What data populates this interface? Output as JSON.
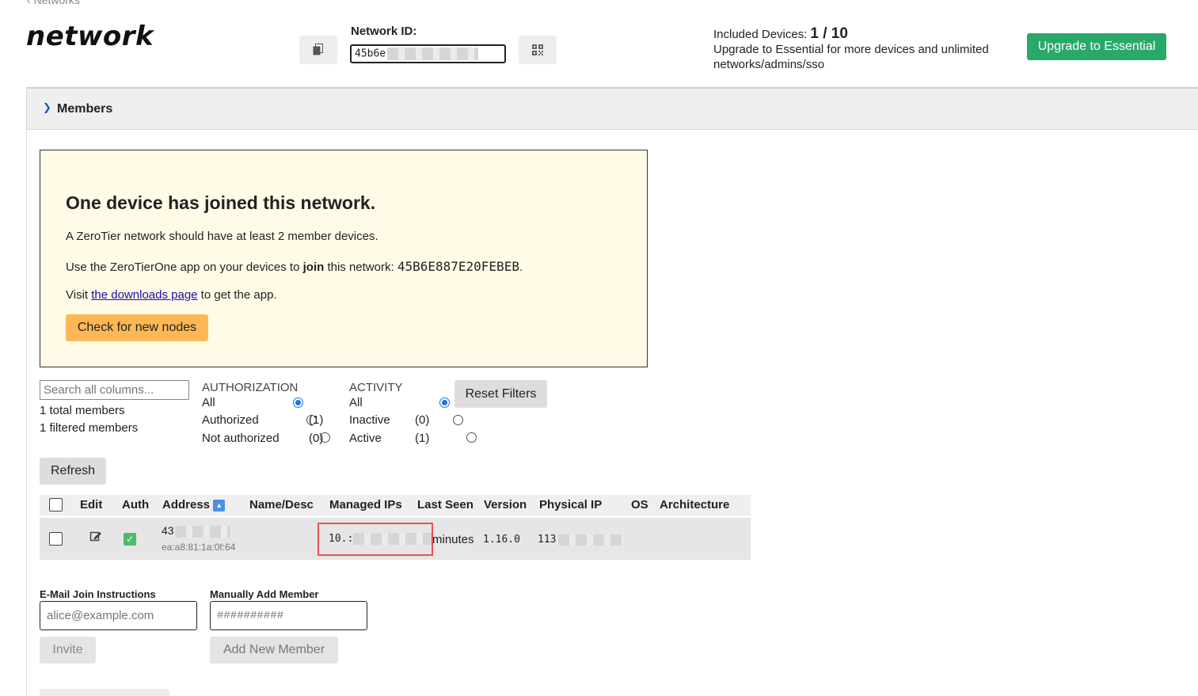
{
  "header": {
    "back_link": "Networks",
    "title": "network",
    "network_id_label": "Network ID:",
    "network_id_value": "45b6e",
    "included_label": "Included Devices:",
    "included_count": "1 / 10",
    "upgrade_text_line1": "Upgrade to Essential for more devices and unlimited",
    "upgrade_text_line2": "networks/admins/sso",
    "upgrade_button": "Upgrade to Essential"
  },
  "members_section": {
    "title": "Members"
  },
  "notice": {
    "heading": "One device has joined this network.",
    "line1": "A ZeroTier network should have at least 2 member devices.",
    "line2_pre": "Use the ZeroTierOne app on your devices to ",
    "line2_bold": "join",
    "line2_mid": " this network: ",
    "network_id": "45B6E887E20FEBEB",
    "line2_post": ".",
    "line3_pre": "Visit ",
    "line3_link": "the downloads page",
    "line3_post": " to get the app.",
    "check_button": "Check for new nodes"
  },
  "filters": {
    "search_placeholder": "Search all columns...",
    "total_members": "1 total members",
    "filtered_members": "1 filtered members",
    "authorization": {
      "title": "AUTHORIZATION",
      "options": [
        {
          "label": "All",
          "count": "",
          "selected": true
        },
        {
          "label": "Authorized",
          "count": "(1)",
          "selected": false
        },
        {
          "label": "Not authorized",
          "count": "(0)",
          "selected": false
        }
      ]
    },
    "activity": {
      "title": "ACTIVITY",
      "options": [
        {
          "label": "All",
          "count": "",
          "selected": true
        },
        {
          "label": "Inactive",
          "count": "(0)",
          "selected": false
        },
        {
          "label": "Active",
          "count": "(1)",
          "selected": false
        }
      ]
    },
    "reset_button": "Reset Filters",
    "refresh_button": "Refresh"
  },
  "table": {
    "columns": [
      "Edit",
      "Auth",
      "Address",
      "Name/Desc",
      "Managed IPs",
      "Last Seen",
      "Version",
      "Physical IP",
      "OS",
      "Architecture"
    ],
    "rows": [
      {
        "address_prefix": "43",
        "mac": "ea:a8:81:1a:0f:64",
        "managed_ip_prefix": "10.:",
        "last_seen": "minutes",
        "version": "1.16.0",
        "physical_ip_prefix": "113"
      }
    ]
  },
  "email_form": {
    "label": "E-Mail Join Instructions",
    "placeholder": "alice@example.com",
    "button": "Invite"
  },
  "add_member_form": {
    "label": "Manually Add Member",
    "placeholder": "##########",
    "button": "Add New Member"
  },
  "colors": {
    "upgrade_green": "#2aa86a",
    "check_orange": "#fdb755",
    "notice_bg": "#fffbe6",
    "highlight_red": "#e05555"
  }
}
